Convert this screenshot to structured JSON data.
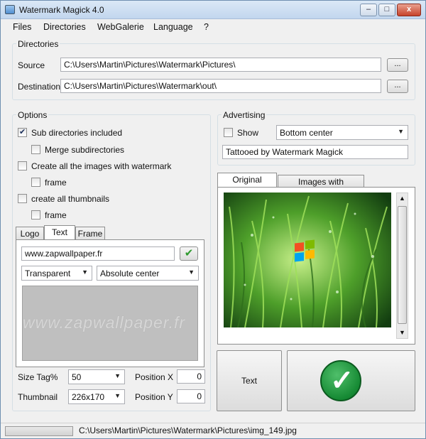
{
  "window": {
    "title": "Watermark Magick 4.0",
    "controls": {
      "minimize": "–",
      "maximize": "□",
      "close": "x"
    }
  },
  "menu": [
    "Files",
    "Directories",
    "WebGalerie",
    "Language",
    "?"
  ],
  "directories": {
    "label": "Directories",
    "source_label": "Source",
    "source_value": "C:\\Users\\Martin\\Pictures\\Watermark\\Pictures\\",
    "destination_label": "Destination",
    "destination_value": "C:\\Users\\Martin\\Pictures\\Watermark\\out\\",
    "browse_label": "..."
  },
  "options": {
    "label": "Options",
    "sub_dirs": {
      "label": "Sub directories included",
      "checked": true
    },
    "merge_subdirs": {
      "label": "Merge subdirectories",
      "checked": false
    },
    "create_watermark": {
      "label": "Create all the images with watermark",
      "checked": false
    },
    "frame1": {
      "label": "frame",
      "checked": false
    },
    "create_thumbnails": {
      "label": "create all thumbnails",
      "checked": false
    },
    "frame2": {
      "label": "frame",
      "checked": false
    }
  },
  "watermark_tabs": [
    "Logo",
    "Text",
    "Frame"
  ],
  "text_tab": {
    "text_value": "www.zapwallpaper.fr",
    "transparency": "Transparent",
    "position": "Absolute center",
    "preview_text": "www.zapwallpaper.fr"
  },
  "size": {
    "size_tag_label": "Size Tag%",
    "size_tag_value": "50",
    "thumbnail_label": "Thumbnail",
    "thumbnail_value": "226x170",
    "position_x_label": "Position X",
    "position_x_value": "0",
    "position_y_label": "Position Y",
    "position_y_value": "0"
  },
  "advertising": {
    "label": "Advertising",
    "show": {
      "label": "Show",
      "checked": false
    },
    "position": "Bottom center",
    "text_value": "Tattooed by Watermark Magick"
  },
  "image_tabs": [
    "Original Images",
    "Images with watermarks"
  ],
  "buttons": {
    "text_label": "Text",
    "ok_icon": "checkmark-icon"
  },
  "status": {
    "path": "C:\\Users\\Martin\\Pictures\\Watermark\\Pictures\\img_149.jpg"
  },
  "colors": {
    "ok_green": "#168a34",
    "title_bar": "#c2d6ee"
  }
}
